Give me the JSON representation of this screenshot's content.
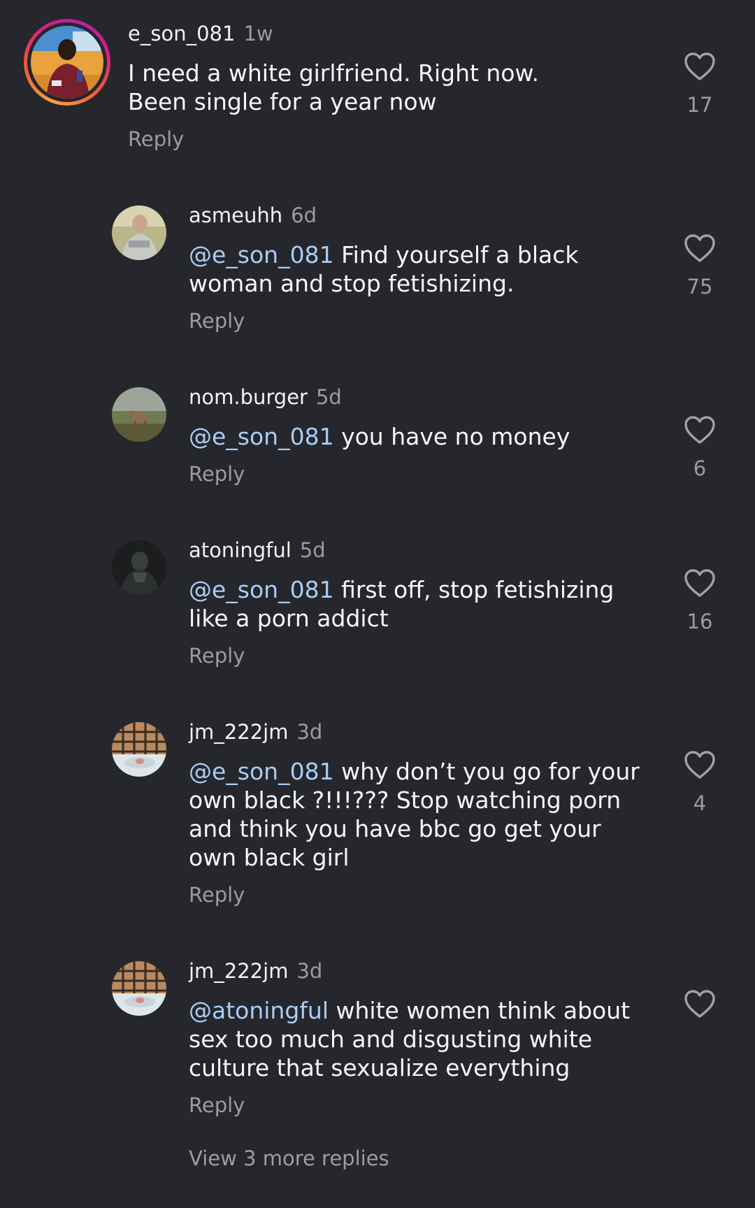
{
  "comments": [
    {
      "username": "e_son_081",
      "time": "1w",
      "mention": "",
      "text": "I need a white girlfriend. Right now.  Been single for a year now",
      "reply_label": "Reply",
      "likes": "17",
      "avatar": "profile-photo-man-seated"
    },
    {
      "username": "asmeuhh",
      "time": "6d",
      "mention": "@e_son_081",
      "text": " Find yourself a black woman and stop fetishizing.",
      "reply_label": "Reply",
      "likes": "75",
      "avatar": "profile-photo-person-outdoors"
    },
    {
      "username": "nom.burger",
      "time": "5d",
      "mention": "@e_son_081",
      "text": " you have no money",
      "reply_label": "Reply",
      "likes": "6",
      "avatar": "profile-photo-deer"
    },
    {
      "username": "atoningful",
      "time": "5d",
      "mention": "@e_son_081",
      "text": " first off, stop fetishizing like a porn addict",
      "reply_label": "Reply",
      "likes": "16",
      "avatar": "profile-photo-dark-figure"
    },
    {
      "username": "jm_222jm",
      "time": "3d",
      "mention": "@e_son_081",
      "text": " why don’t you go for your own black ?!!!??? Stop watching porn and think you have bbc go get your own black girl",
      "reply_label": "Reply",
      "likes": "4",
      "avatar": "profile-photo-bath-window"
    },
    {
      "username": "jm_222jm",
      "time": "3d",
      "mention": "@atoningful",
      "text": " white women think about sex too much and disgusting white culture that sexualize everything",
      "reply_label": "Reply",
      "likes": "",
      "avatar": "profile-photo-bath-window"
    }
  ],
  "view_more_replies": "View 3 more replies",
  "icons": {
    "like": "heart-outline-icon"
  },
  "colors": {
    "background": "#25272c",
    "mention": "#a9cdf6",
    "secondary_text": "#9a9ca3"
  }
}
